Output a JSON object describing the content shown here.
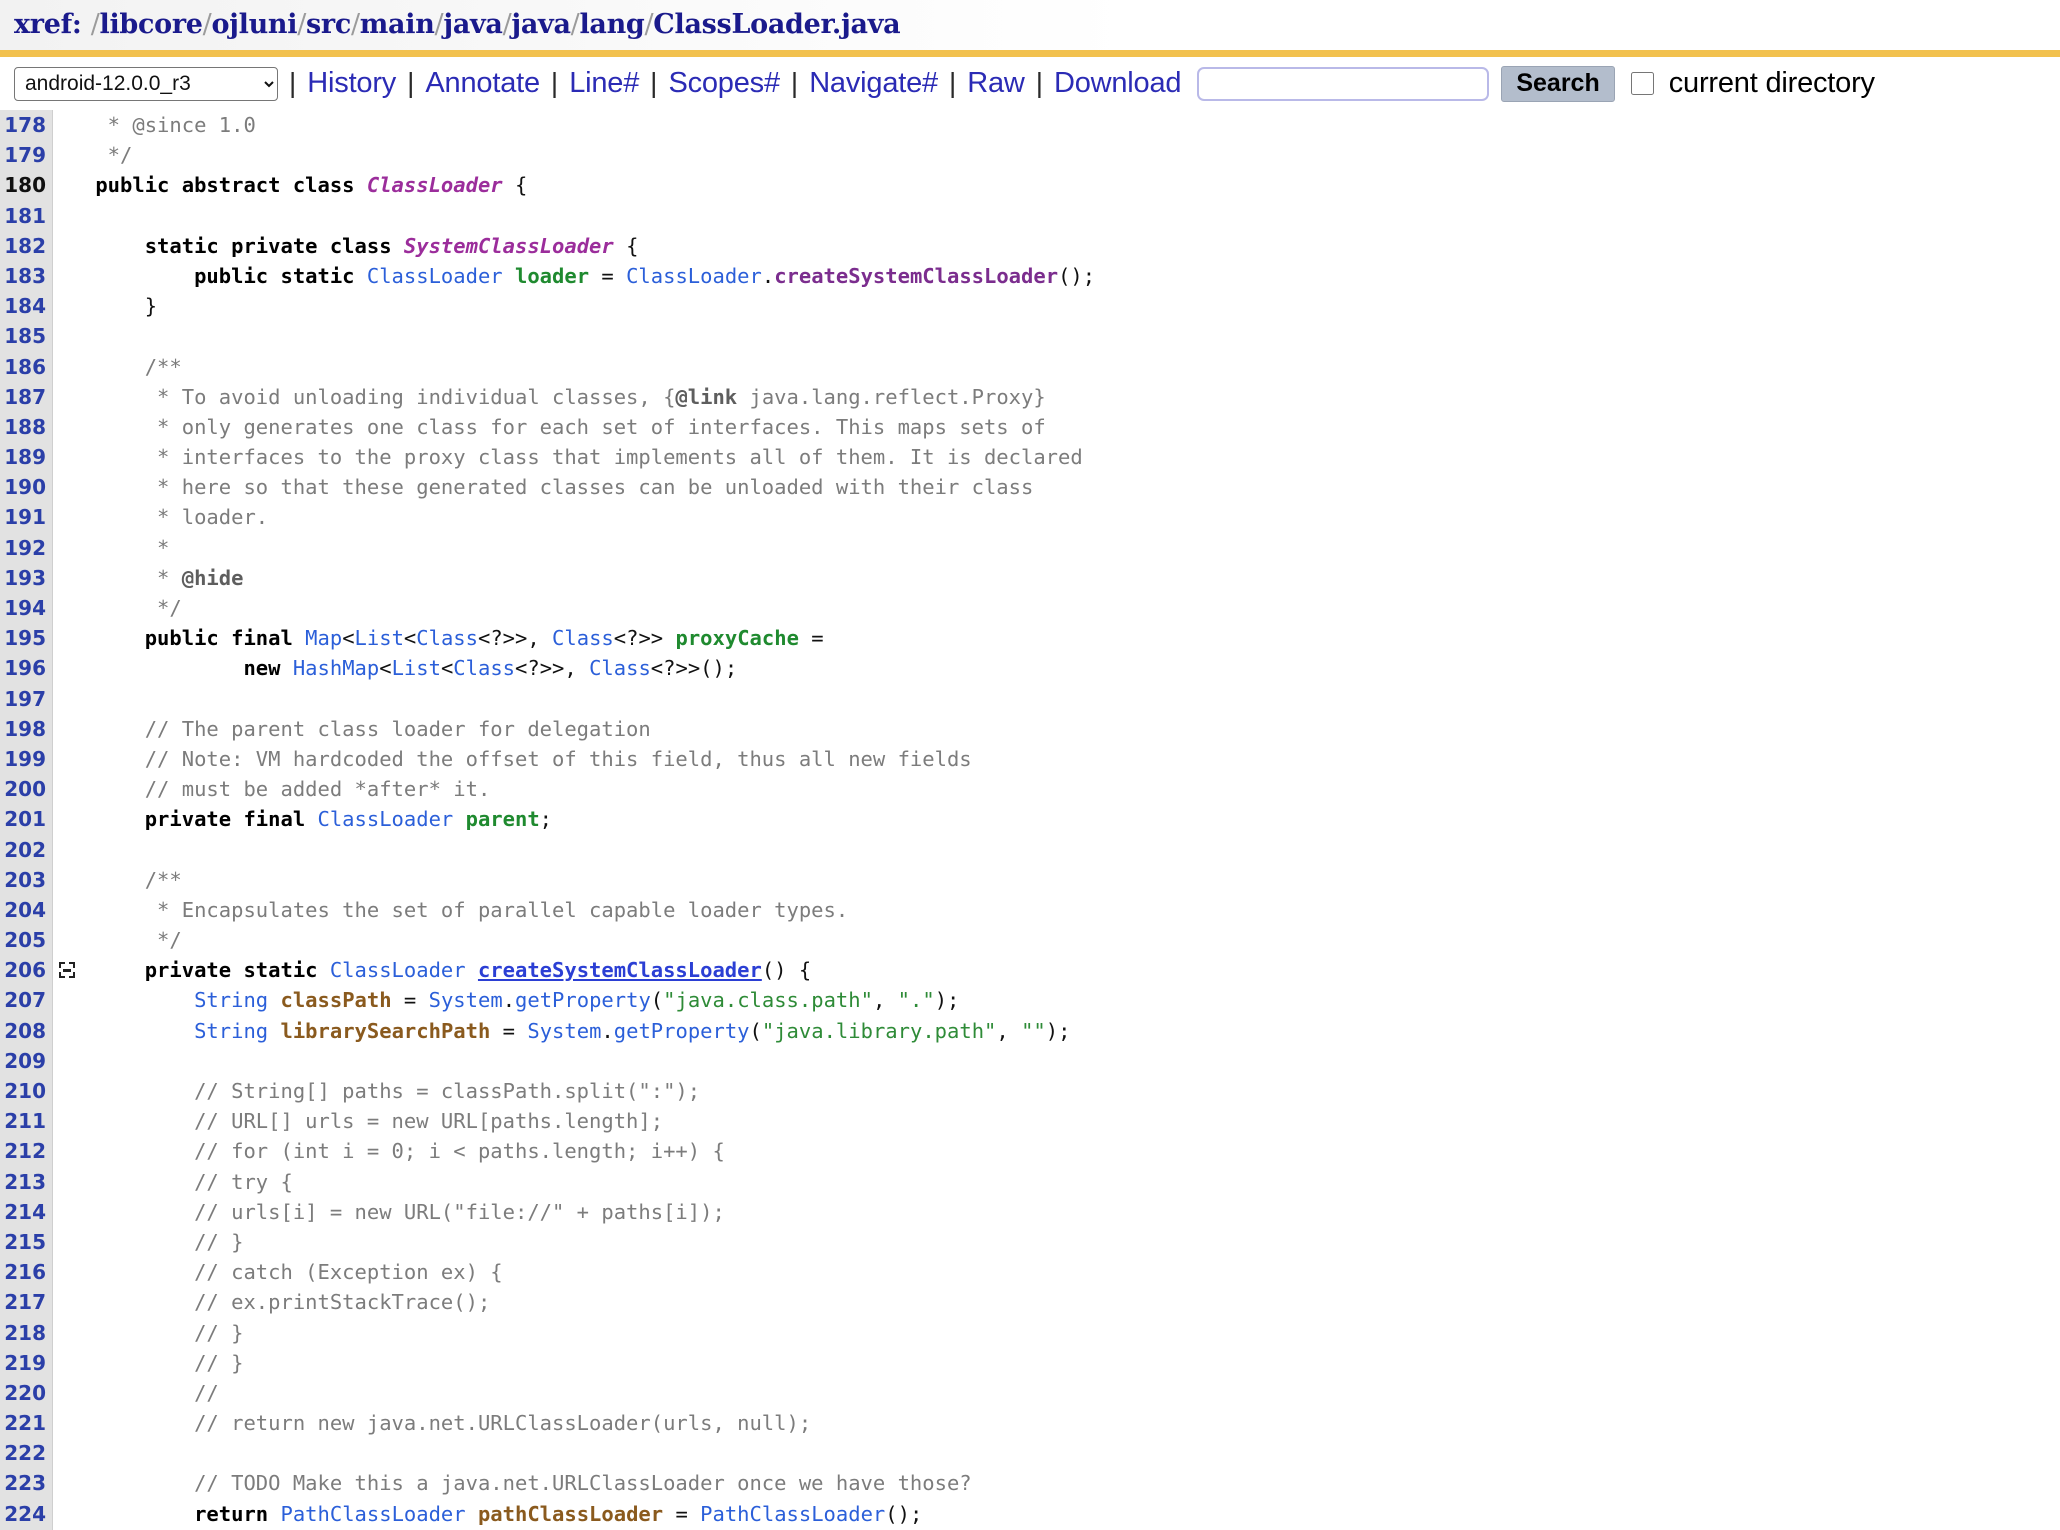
{
  "header": {
    "xref_label": "xref:",
    "path_full": "/libcore/ojluni/src/main/java/java/lang/ClassLoader.java",
    "path_segments": [
      "libcore",
      "ojluni",
      "src",
      "main",
      "java",
      "java",
      "lang",
      "ClassLoader.java"
    ],
    "rule_color": "#f2c14e"
  },
  "toolbar": {
    "project_selected": "android-12.0.0_r3",
    "project_options": [
      "android-12.0.0_r3"
    ],
    "links": [
      "History",
      "Annotate",
      "Line#",
      "Scopes#",
      "Navigate#",
      "Raw",
      "Download"
    ],
    "separator": "|",
    "search_value": "",
    "search_placeholder": "",
    "search_button_label": "Search",
    "current_directory_label": "current directory",
    "current_directory_checked": false
  },
  "code": {
    "first_line": 178,
    "lines": [
      {
        "n": 178,
        "anchor": false,
        "fold": false,
        "tokens": [
          {
            "t": "  * @since 1.0",
            "c": "c-comment"
          }
        ]
      },
      {
        "n": 179,
        "anchor": false,
        "fold": false,
        "tokens": [
          {
            "t": "  */",
            "c": "c-comment"
          }
        ]
      },
      {
        "n": 180,
        "anchor": true,
        "fold": false,
        "tokens": [
          {
            "t": " public abstract class ",
            "c": "c-kw"
          },
          {
            "t": "ClassLoader",
            "c": "c-class"
          },
          {
            "t": " {",
            "c": "c-punct"
          }
        ]
      },
      {
        "n": 181,
        "anchor": false,
        "fold": false,
        "tokens": []
      },
      {
        "n": 182,
        "anchor": false,
        "fold": false,
        "tokens": [
          {
            "t": "     static private class ",
            "c": "c-kw"
          },
          {
            "t": "SystemClassLoader",
            "c": "c-class"
          },
          {
            "t": " {",
            "c": "c-punct"
          }
        ]
      },
      {
        "n": 183,
        "anchor": false,
        "fold": false,
        "tokens": [
          {
            "t": "         public static ",
            "c": "c-kw"
          },
          {
            "t": "ClassLoader",
            "c": "c-type"
          },
          {
            "t": " ",
            "c": "c-plain"
          },
          {
            "t": "loader",
            "c": "c-var"
          },
          {
            "t": " = ",
            "c": "c-punct"
          },
          {
            "t": "ClassLoader",
            "c": "c-type"
          },
          {
            "t": ".",
            "c": "c-punct"
          },
          {
            "t": "createSystemClassLoader",
            "c": "c-method"
          },
          {
            "t": "();",
            "c": "c-punct"
          }
        ]
      },
      {
        "n": 184,
        "anchor": false,
        "fold": false,
        "tokens": [
          {
            "t": "     }",
            "c": "c-punct"
          }
        ]
      },
      {
        "n": 185,
        "anchor": false,
        "fold": false,
        "tokens": []
      },
      {
        "n": 186,
        "anchor": false,
        "fold": false,
        "tokens": [
          {
            "t": "     /**",
            "c": "c-comment"
          }
        ]
      },
      {
        "n": 187,
        "anchor": false,
        "fold": false,
        "tokens": [
          {
            "t": "      * To avoid unloading individual classes, {",
            "c": "c-comment"
          },
          {
            "t": "@link",
            "c": "c-cbold"
          },
          {
            "t": " java.lang.reflect.Proxy}",
            "c": "c-comment"
          }
        ]
      },
      {
        "n": 188,
        "anchor": false,
        "fold": false,
        "tokens": [
          {
            "t": "      * only generates one class for each set of interfaces. This maps sets of",
            "c": "c-comment"
          }
        ]
      },
      {
        "n": 189,
        "anchor": false,
        "fold": false,
        "tokens": [
          {
            "t": "      * interfaces to the proxy class that implements all of them. It is declared",
            "c": "c-comment"
          }
        ]
      },
      {
        "n": 190,
        "anchor": false,
        "fold": false,
        "tokens": [
          {
            "t": "      * here so that these generated classes can be unloaded with their class",
            "c": "c-comment"
          }
        ]
      },
      {
        "n": 191,
        "anchor": false,
        "fold": false,
        "tokens": [
          {
            "t": "      * loader.",
            "c": "c-comment"
          }
        ]
      },
      {
        "n": 192,
        "anchor": false,
        "fold": false,
        "tokens": [
          {
            "t": "      *",
            "c": "c-comment"
          }
        ]
      },
      {
        "n": 193,
        "anchor": false,
        "fold": false,
        "tokens": [
          {
            "t": "      * ",
            "c": "c-comment"
          },
          {
            "t": "@hide",
            "c": "c-cbold"
          }
        ]
      },
      {
        "n": 194,
        "anchor": false,
        "fold": false,
        "tokens": [
          {
            "t": "      */",
            "c": "c-comment"
          }
        ]
      },
      {
        "n": 195,
        "anchor": false,
        "fold": false,
        "tokens": [
          {
            "t": "     public final ",
            "c": "c-kw"
          },
          {
            "t": "Map",
            "c": "c-type"
          },
          {
            "t": "<",
            "c": "c-punct"
          },
          {
            "t": "List",
            "c": "c-type"
          },
          {
            "t": "<",
            "c": "c-punct"
          },
          {
            "t": "Class",
            "c": "c-type"
          },
          {
            "t": "<?>>, ",
            "c": "c-punct"
          },
          {
            "t": "Class",
            "c": "c-type"
          },
          {
            "t": "<?>> ",
            "c": "c-punct"
          },
          {
            "t": "proxyCache",
            "c": "c-var"
          },
          {
            "t": " =",
            "c": "c-punct"
          }
        ]
      },
      {
        "n": 196,
        "anchor": false,
        "fold": false,
        "tokens": [
          {
            "t": "             new ",
            "c": "c-kw"
          },
          {
            "t": "HashMap",
            "c": "c-type"
          },
          {
            "t": "<",
            "c": "c-punct"
          },
          {
            "t": "List",
            "c": "c-type"
          },
          {
            "t": "<",
            "c": "c-punct"
          },
          {
            "t": "Class",
            "c": "c-type"
          },
          {
            "t": "<?>>, ",
            "c": "c-punct"
          },
          {
            "t": "Class",
            "c": "c-type"
          },
          {
            "t": "<?>>();",
            "c": "c-punct"
          }
        ]
      },
      {
        "n": 197,
        "anchor": false,
        "fold": false,
        "tokens": []
      },
      {
        "n": 198,
        "anchor": false,
        "fold": false,
        "tokens": [
          {
            "t": "     // The parent class loader for delegation",
            "c": "c-comment"
          }
        ]
      },
      {
        "n": 199,
        "anchor": false,
        "fold": false,
        "tokens": [
          {
            "t": "     // Note: VM hardcoded the offset of this field, thus all new fields",
            "c": "c-comment"
          }
        ]
      },
      {
        "n": 200,
        "anchor": false,
        "fold": false,
        "tokens": [
          {
            "t": "     // must be added *after* it.",
            "c": "c-comment"
          }
        ]
      },
      {
        "n": 201,
        "anchor": false,
        "fold": false,
        "tokens": [
          {
            "t": "     private final ",
            "c": "c-kw"
          },
          {
            "t": "ClassLoader",
            "c": "c-type"
          },
          {
            "t": " ",
            "c": "c-plain"
          },
          {
            "t": "parent",
            "c": "c-var"
          },
          {
            "t": ";",
            "c": "c-punct"
          }
        ]
      },
      {
        "n": 202,
        "anchor": false,
        "fold": false,
        "tokens": []
      },
      {
        "n": 203,
        "anchor": false,
        "fold": false,
        "tokens": [
          {
            "t": "     /**",
            "c": "c-comment"
          }
        ]
      },
      {
        "n": 204,
        "anchor": false,
        "fold": false,
        "tokens": [
          {
            "t": "      * Encapsulates the set of parallel capable loader types.",
            "c": "c-comment"
          }
        ]
      },
      {
        "n": 205,
        "anchor": false,
        "fold": false,
        "tokens": [
          {
            "t": "      */",
            "c": "c-comment"
          }
        ]
      },
      {
        "n": 206,
        "anchor": false,
        "fold": true,
        "tokens": [
          {
            "t": "     private static ",
            "c": "c-kw"
          },
          {
            "t": "ClassLoader",
            "c": "c-type"
          },
          {
            "t": " ",
            "c": "c-plain"
          },
          {
            "t": "createSystemClassLoader",
            "c": "c-defn"
          },
          {
            "t": "() {",
            "c": "c-punct"
          }
        ]
      },
      {
        "n": 207,
        "anchor": false,
        "fold": false,
        "tokens": [
          {
            "t": "         ",
            "c": "c-plain"
          },
          {
            "t": "String",
            "c": "c-type"
          },
          {
            "t": " ",
            "c": "c-plain"
          },
          {
            "t": "classPath",
            "c": "c-local"
          },
          {
            "t": " = ",
            "c": "c-punct"
          },
          {
            "t": "System",
            "c": "c-type"
          },
          {
            "t": ".",
            "c": "c-punct"
          },
          {
            "t": "getProperty",
            "c": "c-type"
          },
          {
            "t": "(",
            "c": "c-punct"
          },
          {
            "t": "\"java.class.path\"",
            "c": "c-string"
          },
          {
            "t": ", ",
            "c": "c-punct"
          },
          {
            "t": "\".\"",
            "c": "c-string"
          },
          {
            "t": ");",
            "c": "c-punct"
          }
        ]
      },
      {
        "n": 208,
        "anchor": false,
        "fold": false,
        "tokens": [
          {
            "t": "         ",
            "c": "c-plain"
          },
          {
            "t": "String",
            "c": "c-type"
          },
          {
            "t": " ",
            "c": "c-plain"
          },
          {
            "t": "librarySearchPath",
            "c": "c-local"
          },
          {
            "t": " = ",
            "c": "c-punct"
          },
          {
            "t": "System",
            "c": "c-type"
          },
          {
            "t": ".",
            "c": "c-punct"
          },
          {
            "t": "getProperty",
            "c": "c-type"
          },
          {
            "t": "(",
            "c": "c-punct"
          },
          {
            "t": "\"java.library.path\"",
            "c": "c-string"
          },
          {
            "t": ", ",
            "c": "c-punct"
          },
          {
            "t": "\"\"",
            "c": "c-string"
          },
          {
            "t": ");",
            "c": "c-punct"
          }
        ]
      },
      {
        "n": 209,
        "anchor": false,
        "fold": false,
        "tokens": []
      },
      {
        "n": 210,
        "anchor": false,
        "fold": false,
        "tokens": [
          {
            "t": "         // String[] paths = classPath.split(\":\");",
            "c": "c-comment"
          }
        ]
      },
      {
        "n": 211,
        "anchor": false,
        "fold": false,
        "tokens": [
          {
            "t": "         // URL[] urls = new URL[paths.length];",
            "c": "c-comment"
          }
        ]
      },
      {
        "n": 212,
        "anchor": false,
        "fold": false,
        "tokens": [
          {
            "t": "         // for (int i = 0; i < paths.length; i++) {",
            "c": "c-comment"
          }
        ]
      },
      {
        "n": 213,
        "anchor": false,
        "fold": false,
        "tokens": [
          {
            "t": "         // try {",
            "c": "c-comment"
          }
        ]
      },
      {
        "n": 214,
        "anchor": false,
        "fold": false,
        "tokens": [
          {
            "t": "         // urls[i] = new URL(\"file://\" + paths[i]);",
            "c": "c-comment"
          }
        ]
      },
      {
        "n": 215,
        "anchor": false,
        "fold": false,
        "tokens": [
          {
            "t": "         // }",
            "c": "c-comment"
          }
        ]
      },
      {
        "n": 216,
        "anchor": false,
        "fold": false,
        "tokens": [
          {
            "t": "         // catch (Exception ex) {",
            "c": "c-comment"
          }
        ]
      },
      {
        "n": 217,
        "anchor": false,
        "fold": false,
        "tokens": [
          {
            "t": "         // ex.printStackTrace();",
            "c": "c-comment"
          }
        ]
      },
      {
        "n": 218,
        "anchor": false,
        "fold": false,
        "tokens": [
          {
            "t": "         // }",
            "c": "c-comment"
          }
        ]
      },
      {
        "n": 219,
        "anchor": false,
        "fold": false,
        "tokens": [
          {
            "t": "         // }",
            "c": "c-comment"
          }
        ]
      },
      {
        "n": 220,
        "anchor": false,
        "fold": false,
        "tokens": [
          {
            "t": "         //",
            "c": "c-comment"
          }
        ]
      },
      {
        "n": 221,
        "anchor": false,
        "fold": false,
        "tokens": [
          {
            "t": "         // return new java.net.URLClassLoader(urls, null);",
            "c": "c-comment"
          }
        ]
      },
      {
        "n": 222,
        "anchor": false,
        "fold": false,
        "tokens": []
      },
      {
        "n": 223,
        "anchor": false,
        "fold": false,
        "tokens": [
          {
            "t": "         // TODO Make this a java.net.URLClassLoader once we have those?",
            "c": "c-comment"
          }
        ]
      },
      {
        "n": 224,
        "anchor": false,
        "fold": false,
        "tokens": [
          {
            "t": "         return ",
            "c": "c-kw"
          },
          {
            "t": "PathClassLoader",
            "c": "c-type"
          },
          {
            "t": " ",
            "c": "c-plain"
          },
          {
            "t": "pathClassLoader",
            "c": "c-local"
          },
          {
            "t": " = ",
            "c": "c-punct"
          },
          {
            "t": "PathClassLoader",
            "c": "c-type"
          },
          {
            "t": "();",
            "c": "c-punct"
          }
        ]
      }
    ]
  }
}
